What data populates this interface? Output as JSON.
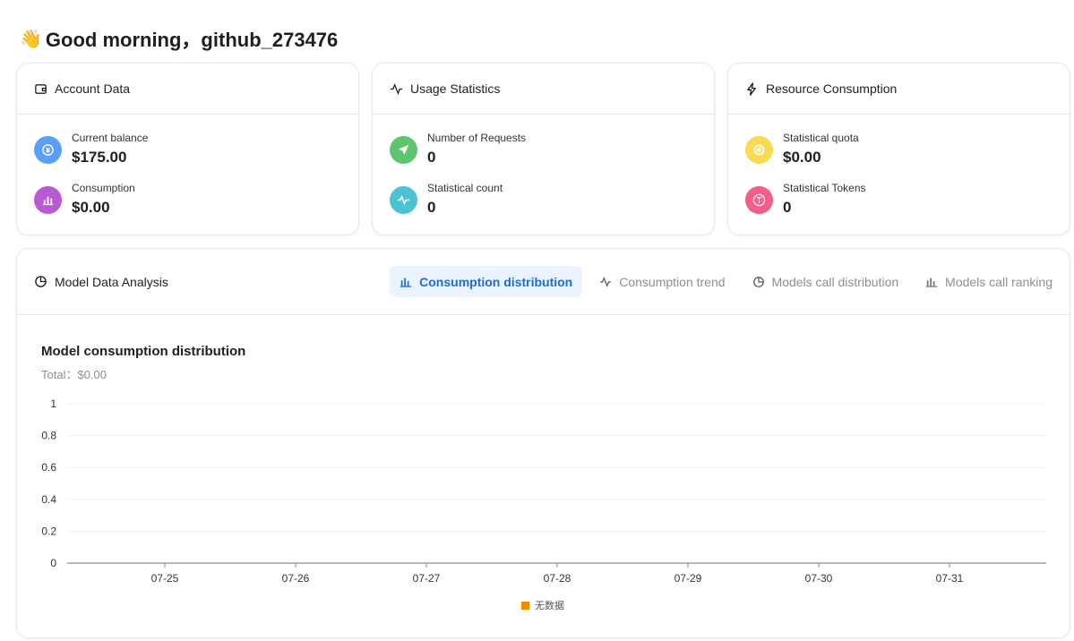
{
  "greeting": {
    "emoji": "👋",
    "text": "Good morning，github_273476"
  },
  "cards": [
    {
      "title": "Account Data",
      "icon": "wallet-icon",
      "items": [
        {
          "label": "Current balance",
          "value": "$175.00",
          "icon": "coin-icon",
          "color": "#5a9ef5"
        },
        {
          "label": "Consumption",
          "value": "$0.00",
          "icon": "bar-chart-icon",
          "color": "#b85ad1"
        }
      ]
    },
    {
      "title": "Usage Statistics",
      "icon": "activity-icon",
      "items": [
        {
          "label": "Number of Requests",
          "value": "0",
          "icon": "send-icon",
          "color": "#5ec46e"
        },
        {
          "label": "Statistical count",
          "value": "0",
          "icon": "pulse-icon",
          "color": "#4cc3d3"
        }
      ]
    },
    {
      "title": "Resource Consumption",
      "icon": "lightning-icon",
      "items": [
        {
          "label": "Statistical quota",
          "value": "$0.00",
          "icon": "quota-coin-icon",
          "color": "#f5dc52"
        },
        {
          "label": "Statistical Tokens",
          "value": "0",
          "icon": "text-t-icon",
          "color": "#ef5f86"
        }
      ]
    }
  ],
  "analysis": {
    "title": "Model Data Analysis",
    "tabs": [
      {
        "label": "Consumption distribution",
        "icon": "bar-chart-icon",
        "active": true
      },
      {
        "label": "Consumption trend",
        "icon": "pulse-icon",
        "active": false
      },
      {
        "label": "Models call distribution",
        "icon": "pie-chart-icon",
        "active": false
      },
      {
        "label": "Models call ranking",
        "icon": "bar-chart-icon",
        "active": false
      }
    ],
    "chart_title": "Model consumption distribution",
    "chart_subtitle": "Total：$0.00"
  },
  "chart_data": {
    "type": "bar",
    "title": "Model consumption distribution",
    "categories": [
      "07-25",
      "07-26",
      "07-27",
      "07-28",
      "07-29",
      "07-30",
      "07-31"
    ],
    "series": [
      {
        "name": "无数据",
        "values": [
          0,
          0,
          0,
          0,
          0,
          0,
          0
        ],
        "color": "#f08c00"
      }
    ],
    "yticks": [
      "0",
      "0.2",
      "0.4",
      "0.6",
      "0.8",
      "1"
    ],
    "ylim": [
      0,
      1
    ],
    "grid": true,
    "legend": "bottom"
  }
}
